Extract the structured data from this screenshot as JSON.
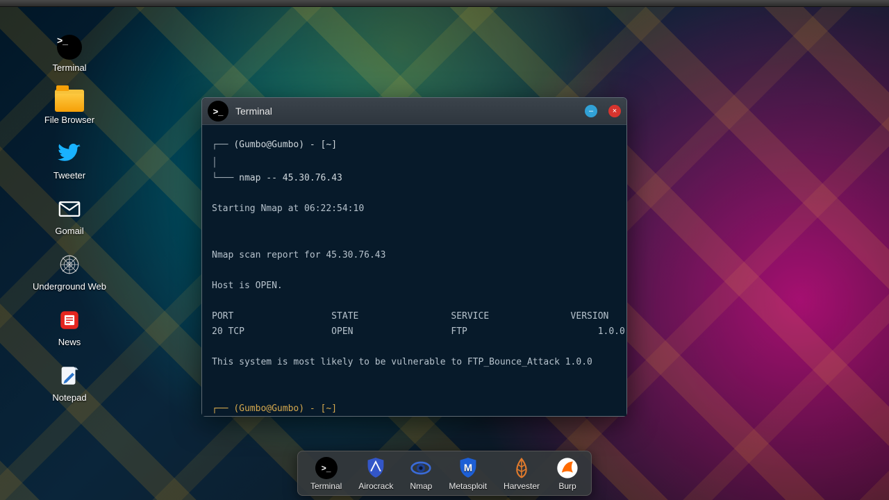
{
  "desktop": {
    "icons": [
      {
        "id": "terminal",
        "label": "Terminal"
      },
      {
        "id": "file-browser",
        "label": "File Browser"
      },
      {
        "id": "tweeter",
        "label": "Tweeter"
      },
      {
        "id": "gomail",
        "label": "Gomail"
      },
      {
        "id": "underground-web",
        "label": "Underground Web"
      },
      {
        "id": "news",
        "label": "News"
      },
      {
        "id": "notepad",
        "label": "Notepad"
      }
    ]
  },
  "window": {
    "title": "Terminal",
    "prompt_user": "(Gumbo@Gumbo) - [~]",
    "command": "nmap -- 45.30.76.43",
    "output": {
      "start": "Starting Nmap at 06:22:54:10",
      "report": "Nmap scan report for 45.30.76.43",
      "host": "Host is OPEN.",
      "columns": "PORT                  STATE                 SERVICE               VERSION",
      "row": "20 TCP                OPEN                  FTP                        1.0.0",
      "vuln": "This system is most likely to be vulnerable to FTP_Bounce_Attack 1.0.0"
    }
  },
  "dock": {
    "items": [
      {
        "id": "terminal",
        "label": "Terminal"
      },
      {
        "id": "airocrack",
        "label": "Airocrack"
      },
      {
        "id": "nmap",
        "label": "Nmap"
      },
      {
        "id": "metasploit",
        "label": "Metasploit"
      },
      {
        "id": "harvester",
        "label": "Harvester"
      },
      {
        "id": "burp",
        "label": "Burp"
      }
    ]
  }
}
